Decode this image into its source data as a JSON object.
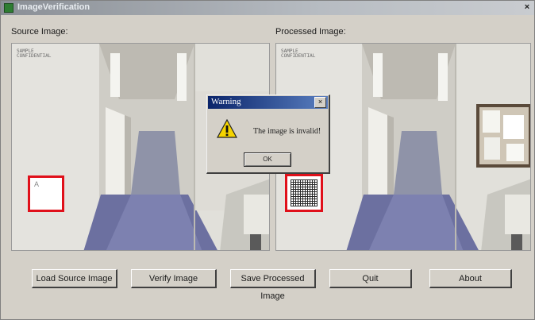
{
  "window": {
    "title": "ImageVerification",
    "close_label": "×"
  },
  "source": {
    "label": "Source Image:",
    "stamp": "SAMPLE\nCONFIDENTIAL",
    "mark_text": "A"
  },
  "processed": {
    "label": "Processed Image:",
    "stamp": "SAMPLE\nCONFIDENTIAL"
  },
  "buttons": {
    "load": "Load Source Image",
    "verify": "Verify Image",
    "save": "Save Processed Image",
    "quit": "Quit",
    "about": "About"
  },
  "dialog": {
    "title": "Warning",
    "close_label": "×",
    "message": "The image is invalid!",
    "ok": "OK"
  },
  "colors": {
    "titlebar": "#8a8f96",
    "dialog_titlebar": "#0a246a",
    "highlight_box": "#e0101a",
    "warning_yellow": "#f5d400"
  }
}
